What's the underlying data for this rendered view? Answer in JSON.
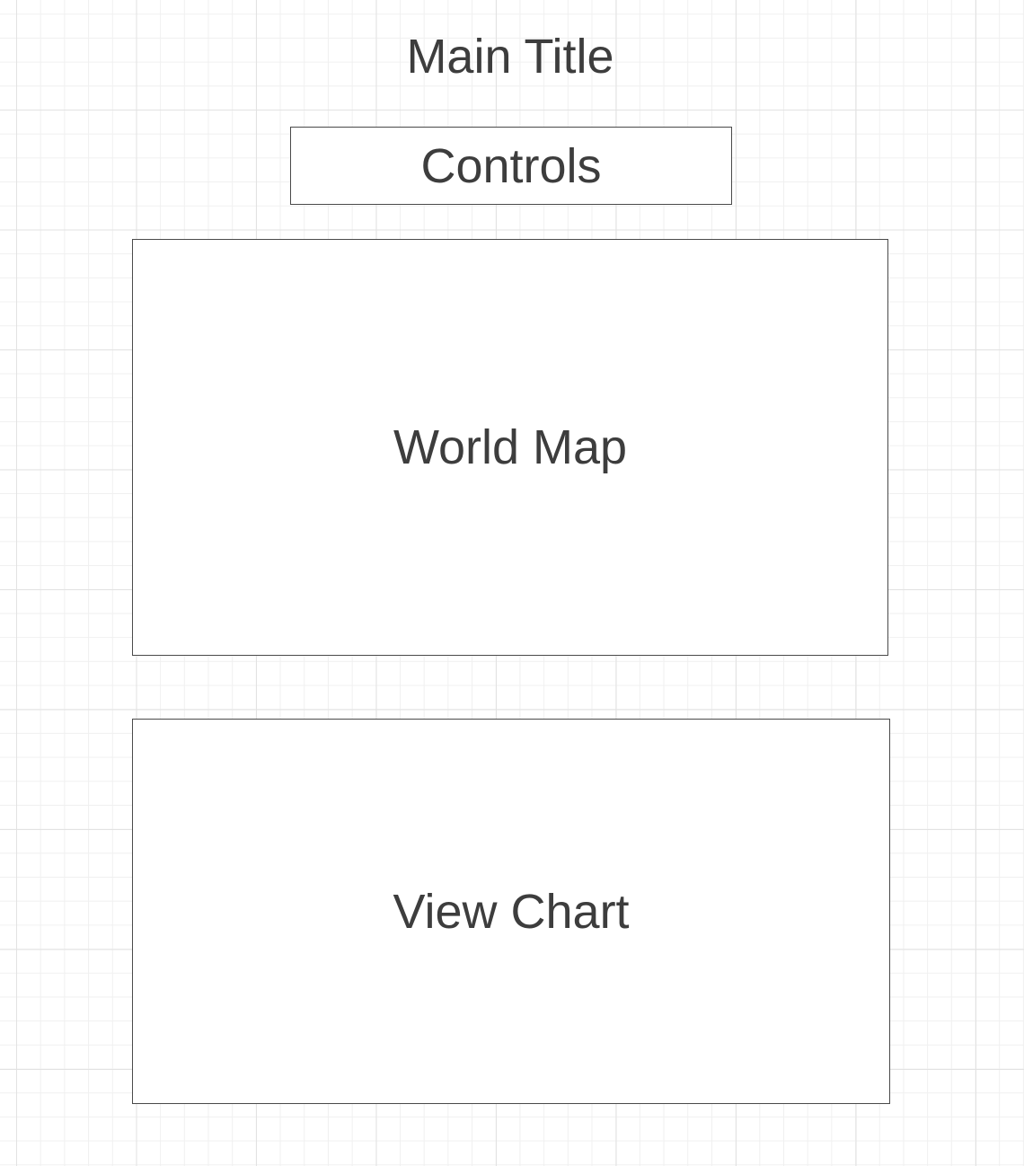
{
  "header": {
    "title": "Main Title"
  },
  "blocks": {
    "controls": "Controls",
    "map": "World Map",
    "chart": "View Chart"
  },
  "colors": {
    "text": "#3d3d3d",
    "border": "#4a4a4a",
    "grid": "#e2e2e2",
    "background": "#ffffff"
  }
}
